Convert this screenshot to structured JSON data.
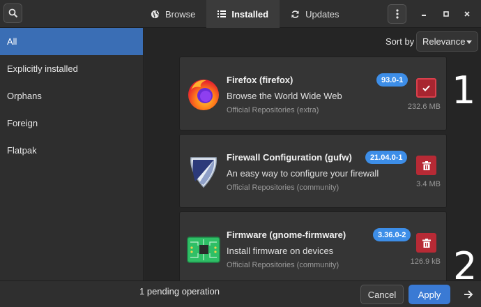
{
  "header": {
    "tabs": [
      {
        "label": "Browse",
        "icon": "globe-icon",
        "active": false
      },
      {
        "label": "Installed",
        "icon": "list-icon",
        "active": true
      },
      {
        "label": "Updates",
        "icon": "refresh-icon",
        "active": false
      }
    ]
  },
  "sidebar": {
    "items": [
      {
        "label": "All",
        "active": true
      },
      {
        "label": "Explicitly installed",
        "active": false
      },
      {
        "label": "Orphans",
        "active": false
      },
      {
        "label": "Foreign",
        "active": false
      },
      {
        "label": "Flatpak",
        "active": false
      }
    ]
  },
  "sort": {
    "label": "Sort by",
    "value": "Relevance"
  },
  "packages": [
    {
      "title": "Firefox (firefox)",
      "description": "Browse the World Wide Web",
      "repo": "Official Repositories (extra)",
      "version": "93.0-1",
      "size": "232.6 MB",
      "action": "marked-for-removal",
      "icon": "firefox-icon"
    },
    {
      "title": "Firewall Configuration (gufw)",
      "description": "An easy way to configure your firewall",
      "repo": "Official Repositories (community)",
      "version": "21.04.0-1",
      "size": "3.4 MB",
      "action": "remove",
      "icon": "shield-icon"
    },
    {
      "title": "Firmware (gnome-firmware)",
      "description": "Install firmware on devices",
      "repo": "Official Repositories (community)",
      "version": "3.36.0-2",
      "size": "126.9 kB",
      "action": "remove",
      "icon": "circuit-board-icon"
    }
  ],
  "footer": {
    "pending": "1 pending operation",
    "cancel": "Cancel",
    "apply": "Apply"
  },
  "annotations": {
    "one": "1",
    "two": "2"
  },
  "colors": {
    "accent": "#3a6eb5",
    "badge": "#3d8ee8",
    "danger": "#b72a35",
    "apply": "#3a7ad4"
  }
}
